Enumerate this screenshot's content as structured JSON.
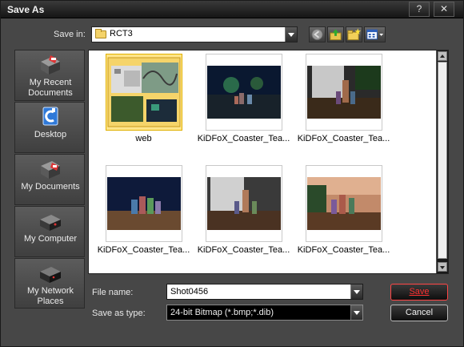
{
  "window": {
    "title": "Save As",
    "help_glyph": "?",
    "close_glyph": "✕"
  },
  "save_in": {
    "label": "Save in:",
    "value": "RCT3",
    "icon": "folder-icon"
  },
  "toolbar": {
    "back_icon": "back-arrow-icon",
    "up_icon": "up-one-level-icon",
    "new_folder_icon": "new-folder-icon",
    "views_icon": "views-menu-icon"
  },
  "places": [
    {
      "label": "My Recent Documents",
      "icon": "recent-documents-icon"
    },
    {
      "label": "Desktop",
      "icon": "desktop-icon"
    },
    {
      "label": "My Documents",
      "icon": "my-documents-icon"
    },
    {
      "label": "My Computer",
      "icon": "my-computer-icon"
    },
    {
      "label": "My Network Places",
      "icon": "network-places-icon"
    }
  ],
  "files": [
    {
      "name": "web",
      "kind": "folder"
    },
    {
      "name": "KiDFoX_Coaster_Tea...",
      "kind": "image"
    },
    {
      "name": "KiDFoX_Coaster_Tea...",
      "kind": "image"
    },
    {
      "name": "KiDFoX_Coaster_Tea...",
      "kind": "image"
    },
    {
      "name": "KiDFoX_Coaster_Tea...",
      "kind": "image"
    },
    {
      "name": "KiDFoX_Coaster_Tea...",
      "kind": "image"
    }
  ],
  "file_name": {
    "label": "File name:",
    "value": "Shot0456"
  },
  "save_as_type": {
    "label": "Save as type:",
    "value": "24-bit Bitmap (*.bmp;*.dib)"
  },
  "buttons": {
    "save": "Save",
    "cancel": "Cancel"
  },
  "colors": {
    "accent_save": "#ff3030",
    "dialog_bg": "#474747"
  }
}
